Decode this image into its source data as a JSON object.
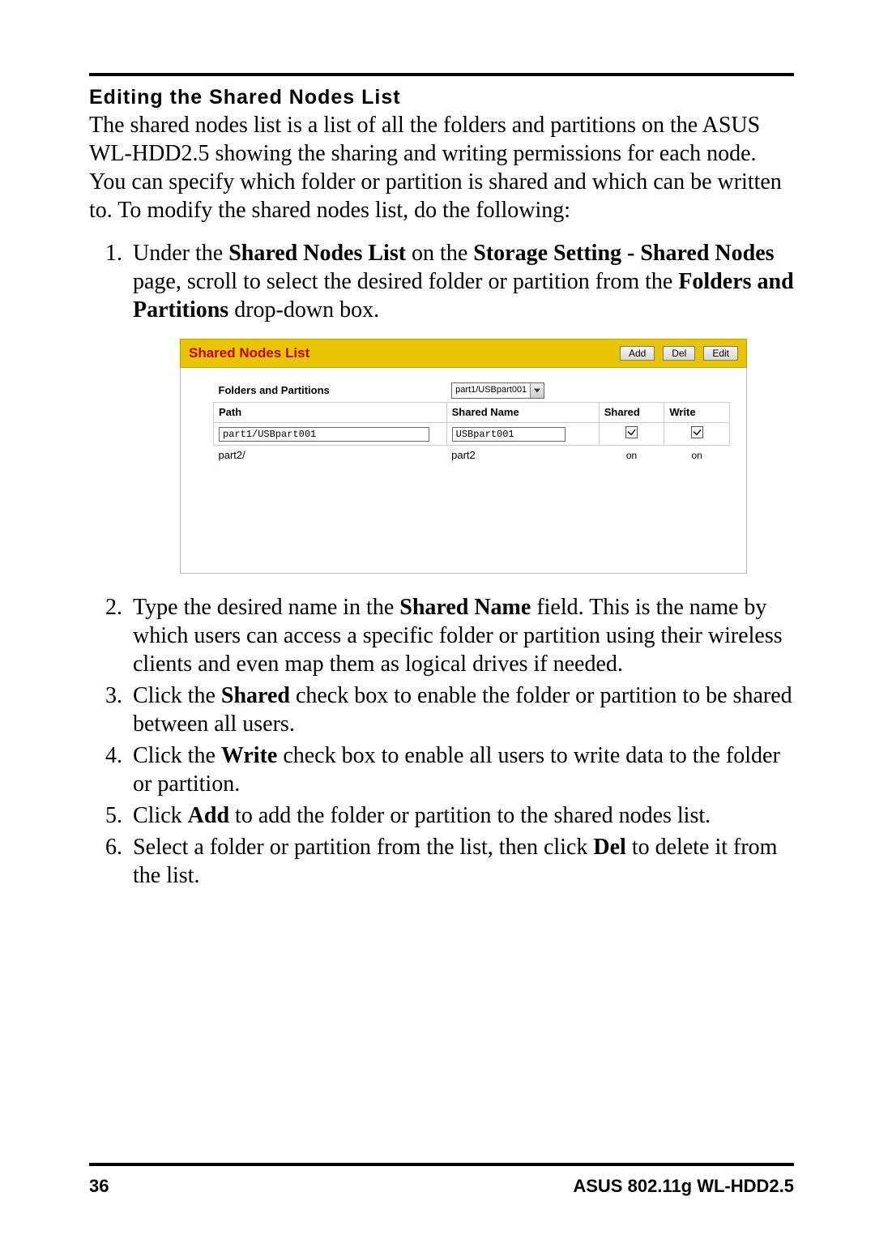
{
  "heading": "Editing the Shared Nodes List",
  "intro": "The shared nodes list is a list of all the folders and partitions on the ASUS WL-HDD2.5 showing the sharing and writing permissions for each node. You can specify which folder or partition is shared and which can be written to. To modify the shared nodes list, do the following:",
  "step1": {
    "t1": "Under the ",
    "b1": "Shared Nodes List",
    "t2": " on the ",
    "b2": "Storage Setting - Shared Nodes",
    "t3": " page, scroll to select the desired folder or partition from the ",
    "b3": "Folders and Partitions",
    "t4": " drop-down box."
  },
  "step2": {
    "t1": "Type the desired name in the ",
    "b1": "Shared Name",
    "t2": " field. This is the name by which users can access a specific folder or partition using their wireless clients and even map them as logical drives if needed."
  },
  "step3": {
    "t1": "Click the ",
    "b1": "Shared",
    "t2": " check box to enable the folder or partition to be shared between all users."
  },
  "step4": {
    "t1": "Click the ",
    "b1": "Write",
    "t2": " check box to enable all users to write data to the folder or partition."
  },
  "step5": {
    "t1": "Click ",
    "b1": "Add",
    "t2": " to add the folder or partition to the shared nodes list."
  },
  "step6": {
    "t1": "Select a folder or partition from the list, then click ",
    "b1": "Del",
    "t2": " to delete it from the list."
  },
  "fig": {
    "title": "Shared Nodes List",
    "btn_add": "Add",
    "btn_del": "Del",
    "btn_edit": "Edit",
    "label_folders": "Folders and Partitions",
    "dd_value": "part1/USBpart001",
    "col_path": "Path",
    "col_shared_name": "Shared Name",
    "col_shared": "Shared",
    "col_write": "Write",
    "row1_path": "part1/USBpart001",
    "row1_name": "USBpart001",
    "row2_path": "part2/",
    "row2_name": "part2",
    "row2_shared": "on",
    "row2_write": "on"
  },
  "footer": {
    "page": "36",
    "title": "ASUS 802.11g WL-HDD2.5"
  }
}
